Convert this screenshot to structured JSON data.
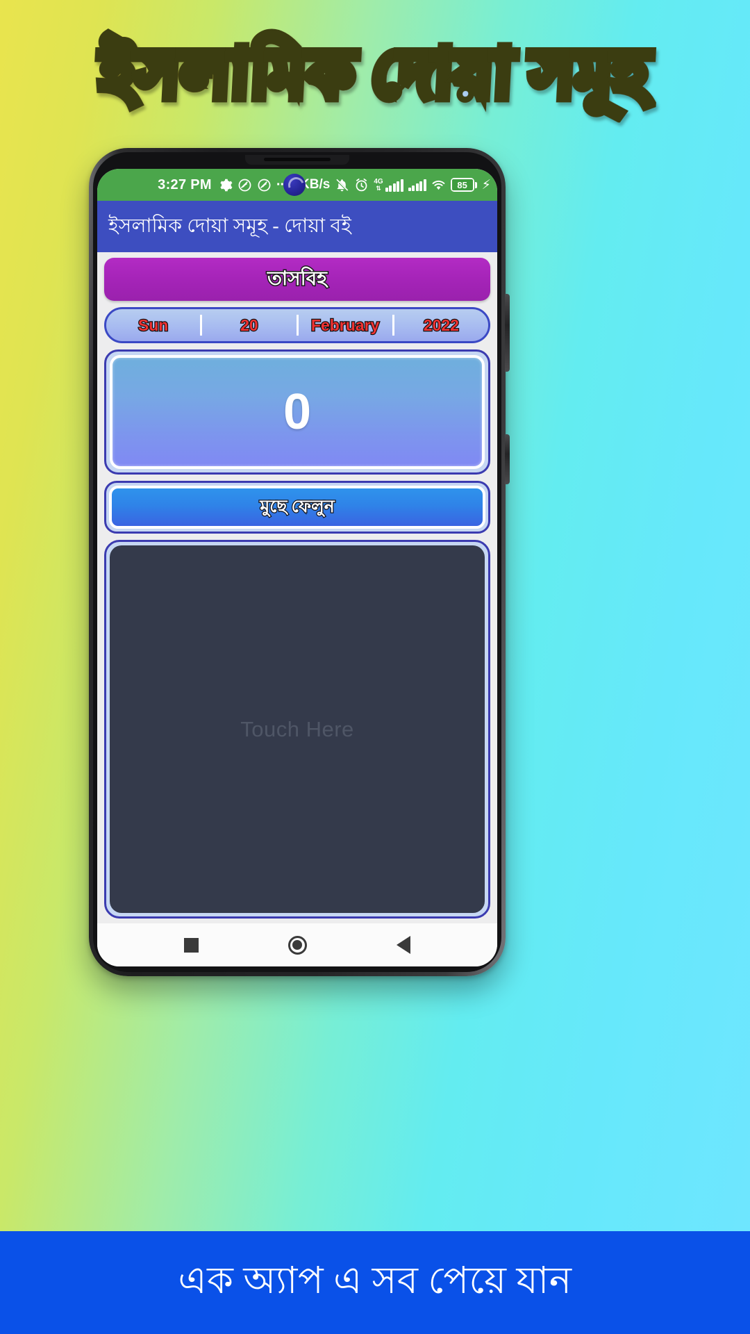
{
  "promo": {
    "headline": "ইসলামিক দোয়া সমূহ",
    "footer_text": "এক অ্যাপ এ সব পেয়ে যান",
    "bg_gradient_start": "#e9e44e",
    "bg_gradient_end": "#6fe6ff",
    "footer_bg": "#0a51e8"
  },
  "status_bar": {
    "time": "3:27 PM",
    "network_speed": "1 KB/s",
    "battery_percent": "85",
    "icons": [
      "gear-icon",
      "do-not-disturb-icon",
      "do-not-disturb-icon",
      "more-dots-icon",
      "bell-off-icon",
      "alarm-icon",
      "signal-4g-icon",
      "signal-icon",
      "wifi-icon",
      "battery-icon",
      "charging-bolt-icon"
    ],
    "network_label": "4G",
    "bg_color": "#4ba64b"
  },
  "app_bar": {
    "title": "ইসলামিক দোয়া সমূহ - দোয়া বই",
    "bg_color": "#3d4ec0"
  },
  "screen": {
    "tasbih_button_label": "তাসবিহ",
    "tasbih_button_color": "#a524b8",
    "date": {
      "weekday": "Sun",
      "day": "20",
      "month": "February",
      "year": "2022",
      "text_color": "#f03232"
    },
    "counter": {
      "value": "0",
      "text_color": "#ffffff"
    },
    "clear_button_label": "মুছে ফেলুন",
    "touch_area_label": "Touch Here",
    "touch_area_color": "#343a4b"
  },
  "nav_bar": {
    "recent_label": "recent-apps",
    "home_label": "home",
    "back_label": "back"
  }
}
